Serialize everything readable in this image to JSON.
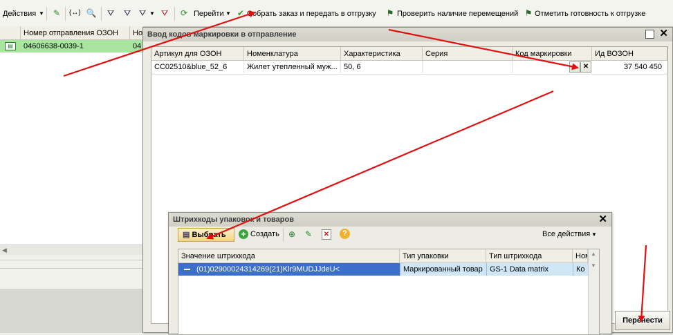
{
  "toolbar": {
    "actions": "Действия",
    "goto": "Перейти",
    "collect": "Собрать заказ и передать в отгрузку",
    "check_moves": "Проверить наличие перемещений",
    "mark_ready": "Отметить готовность к отгрузке"
  },
  "main_table": {
    "col_number": "Номер отправления ОЗОН",
    "col_next": "Но",
    "row_number": "04606638-0039-1",
    "row_next": "04",
    "colors": {
      "selected_row": "#a8e6a0"
    }
  },
  "marking_window": {
    "title": "Ввод кодов маркировки в отправление",
    "columns": [
      "Артикул для ОЗОН",
      "Номенклатура",
      "Характеристика",
      "Серия",
      "Код маркировки",
      "Ид ВОЗОН"
    ],
    "row": {
      "article": "CC02510&blue_52_6",
      "nomenclature": "Жилет утепленный муж...",
      "characteristic": "50, 6",
      "series": "",
      "marking_code": "",
      "ozon_id": "37 540 450"
    },
    "transfer_button": "Перенести"
  },
  "barcode_window": {
    "title": "Штрихкоды упаковок и товаров",
    "select_button": "Выбрать",
    "create_button": "Создать",
    "all_actions": "Все действия",
    "columns": [
      "Значение штрихкода",
      "Тип упаковки",
      "Тип штрихкода",
      "Ном"
    ],
    "row": {
      "value": "(01)02900024314269(21)Klr9MUDJJdeU<",
      "package_type": "Маркированный товар",
      "barcode_type": "GS-1 Data matrix",
      "next": "Ко"
    },
    "colors": {
      "selected_row": "#3b6fc9",
      "selected_cell": "#cfe6f7"
    }
  }
}
